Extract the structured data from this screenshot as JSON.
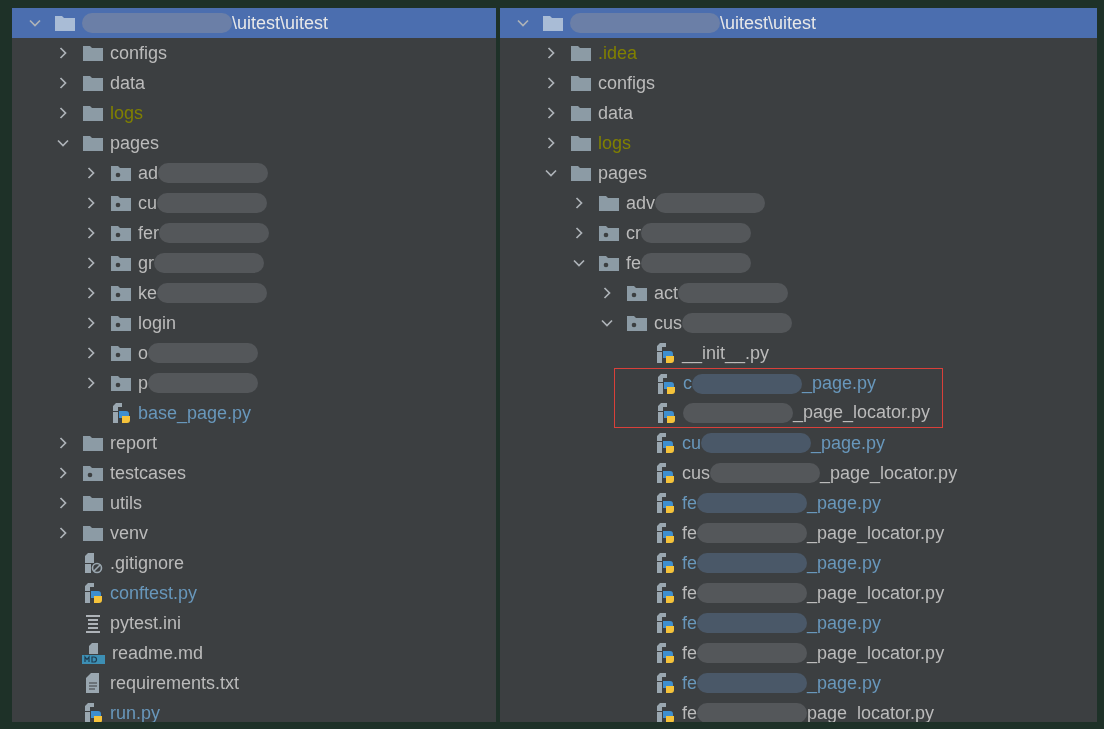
{
  "panels": [
    {
      "root": {
        "redacted": true,
        "after": "\\uitest\\uitest",
        "expanded": true,
        "selected": true
      },
      "children": [
        {
          "text": "configs",
          "kind": "folder",
          "expanded": false
        },
        {
          "text": "data",
          "kind": "folder",
          "expanded": false
        },
        {
          "text": "logs",
          "kind": "folder",
          "color": "#808000",
          "expanded": false
        },
        {
          "text": "pages",
          "kind": "folder",
          "expanded": true,
          "children": [
            {
              "text": "ad",
              "redacted": true,
              "kind": "package",
              "expanded": false
            },
            {
              "text": "cu",
              "redacted": true,
              "kind": "package",
              "expanded": false
            },
            {
              "text": "fer",
              "redacted": true,
              "kind": "package",
              "expanded": false
            },
            {
              "text": "gr",
              "redacted": true,
              "kind": "package",
              "expanded": false
            },
            {
              "text": "ke",
              "redacted": true,
              "kind": "package",
              "expanded": false
            },
            {
              "text": "login",
              "kind": "package",
              "expanded": false
            },
            {
              "text": "o",
              "redacted": true,
              "kind": "package",
              "expanded": false
            },
            {
              "text": "p",
              "redacted": true,
              "kind": "package",
              "expanded": false
            },
            {
              "text": "base_page.py",
              "kind": "python",
              "color": "#6897bb"
            }
          ]
        },
        {
          "text": "report",
          "kind": "folder",
          "expanded": false
        },
        {
          "text": "testcases",
          "kind": "package",
          "expanded": false
        },
        {
          "text": "utils",
          "kind": "folder",
          "expanded": false
        },
        {
          "text": "venv",
          "kind": "folder",
          "expanded": false
        },
        {
          "text": ".gitignore",
          "kind": "gitignore"
        },
        {
          "text": "conftest.py",
          "kind": "python",
          "color": "#6897bb"
        },
        {
          "text": "pytest.ini",
          "kind": "ini"
        },
        {
          "text": "readme.md",
          "kind": "md"
        },
        {
          "text": "requirements.txt",
          "kind": "text"
        },
        {
          "text": "run.py",
          "kind": "python",
          "color": "#6897bb"
        }
      ]
    },
    {
      "root": {
        "redacted": true,
        "after": "\\uitest\\uitest",
        "expanded": true,
        "selected": true
      },
      "children": [
        {
          "text": ".idea",
          "kind": "folder",
          "color": "#808000",
          "expanded": false
        },
        {
          "text": "configs",
          "kind": "folder",
          "expanded": false
        },
        {
          "text": "data",
          "kind": "folder",
          "expanded": false
        },
        {
          "text": "logs",
          "kind": "folder",
          "color": "#808000",
          "expanded": false
        },
        {
          "text": "pages",
          "kind": "folder",
          "expanded": true,
          "children": [
            {
              "text": "adv",
              "redacted": true,
              "kind": "folder",
              "expanded": false
            },
            {
              "text": "cr",
              "redacted": true,
              "kind": "package",
              "expanded": false
            },
            {
              "text": "fe",
              "redacted": true,
              "kind": "package",
              "expanded": true,
              "children": [
                {
                  "text": "act",
                  "redacted": true,
                  "kind": "package",
                  "expanded": false
                },
                {
                  "text": "cus",
                  "redacted": true,
                  "kind": "package",
                  "expanded": true,
                  "children": [
                    {
                      "text": "__init__.py",
                      "kind": "python"
                    },
                    {
                      "text": "c",
                      "redacted": true,
                      "after": "_page.py",
                      "kind": "python",
                      "color": "#6897bb",
                      "boxed": true
                    },
                    {
                      "redacted": true,
                      "after": "_page_locator.py",
                      "kind": "python",
                      "boxed": true
                    },
                    {
                      "text": "cu",
                      "redacted": true,
                      "after": "_page.py",
                      "kind": "python",
                      "color": "#6897bb"
                    },
                    {
                      "text": "cus",
                      "redacted": true,
                      "after": "_page_locator.py",
                      "kind": "python"
                    },
                    {
                      "text": "fe",
                      "redacted": true,
                      "after": "_page.py",
                      "kind": "python",
                      "color": "#6897bb"
                    },
                    {
                      "text": "fe",
                      "redacted": true,
                      "after": "_page_locator.py",
                      "kind": "python"
                    },
                    {
                      "text": "fe",
                      "redacted": true,
                      "after": "_page.py",
                      "kind": "python",
                      "color": "#6897bb"
                    },
                    {
                      "text": "fe",
                      "redacted": true,
                      "after": "_page_locator.py",
                      "kind": "python"
                    },
                    {
                      "text": "fe",
                      "redacted": true,
                      "after": "_page.py",
                      "kind": "python",
                      "color": "#6897bb"
                    },
                    {
                      "text": "fe",
                      "redacted": true,
                      "after": "_page_locator.py",
                      "kind": "python"
                    },
                    {
                      "text": "fe",
                      "redacted": true,
                      "after": "_page.py",
                      "kind": "python",
                      "color": "#6897bb"
                    },
                    {
                      "text": "fe",
                      "redacted": true,
                      "after": "page_locator.py",
                      "kind": "python"
                    }
                  ]
                }
              ]
            }
          ]
        }
      ]
    }
  ]
}
